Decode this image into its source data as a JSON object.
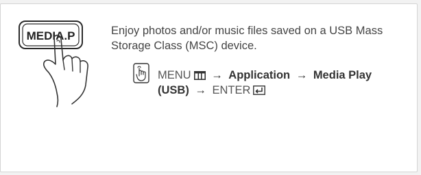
{
  "illustration": {
    "button_label": "MEDIA.P",
    "icon": "hand-pressing-button-icon"
  },
  "intro_text": "Enjoy photos and/or music files saved on a USB Mass Storage Class (MSC) device.",
  "instruction_icon": "remote-hand-press-icon",
  "menu_path": {
    "menu": "MENU",
    "menu_icon": "menu-grid-icon",
    "application": "Application",
    "media_play": "Media Play",
    "usb": "(USB)",
    "enter": "ENTER",
    "enter_icon": "enter-return-icon",
    "arrow": "→"
  }
}
